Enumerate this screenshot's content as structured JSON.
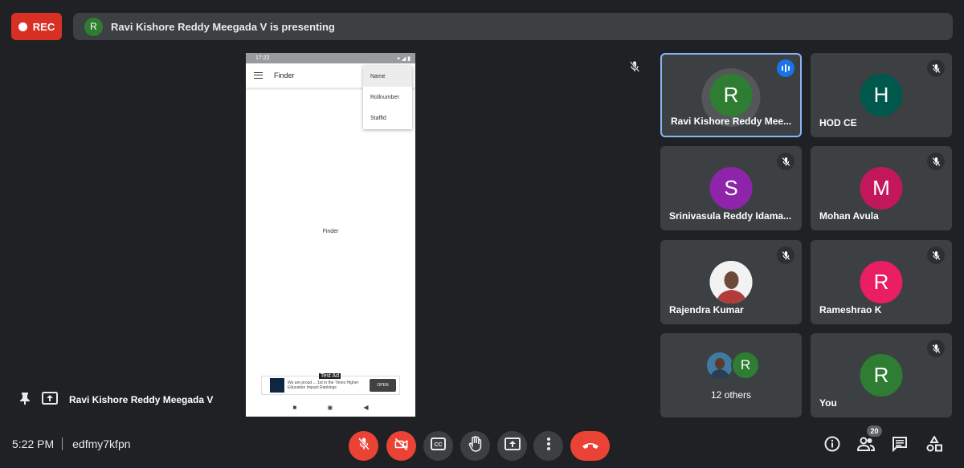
{
  "rec": {
    "label": "REC"
  },
  "banner": {
    "initial": "R",
    "text": "Ravi Kishore Reddy Meegada V is presenting"
  },
  "phone": {
    "status_time": "17:22",
    "status_right": "▾ ◢ ▮",
    "app_title": "Finder",
    "menu": [
      "Name",
      "Rollnumber",
      "Staffid"
    ],
    "center_text": "Finder",
    "ad": {
      "tag": "Test Ad",
      "text": "We are proud ... 1st in the Times Higher Education Impact Rankings",
      "button": "OPEN"
    }
  },
  "tiles": [
    {
      "initial": "R",
      "name": "Ravi Kishore Reddy Mee...",
      "color": "#2e7d32"
    },
    {
      "initial": "H",
      "name": "HOD CE",
      "color": "#00574b"
    },
    {
      "initial": "S",
      "name": "Srinivasula Reddy Idama...",
      "color": "#8e24aa"
    },
    {
      "initial": "M",
      "name": "Mohan Avula",
      "color": "#c2185b"
    },
    {
      "initial": "",
      "name": "Rajendra Kumar",
      "color": "#ffffff"
    },
    {
      "initial": "R",
      "name": "Rameshrao K",
      "color": "#e91e63"
    },
    {
      "initial": "R",
      "name": "12 others",
      "color": "#2e7d32"
    },
    {
      "initial": "R",
      "name": "You",
      "color": "#2e7d32"
    }
  ],
  "presenter": {
    "name": "Ravi Kishore Reddy Meegada V"
  },
  "meeting": {
    "time": "5:22 PM",
    "code": "edfmy7kfpn"
  },
  "participants_count": "20",
  "colors": {
    "danger": "#ea4335",
    "accent": "#8ab4f8",
    "tile": "#3c4043"
  }
}
